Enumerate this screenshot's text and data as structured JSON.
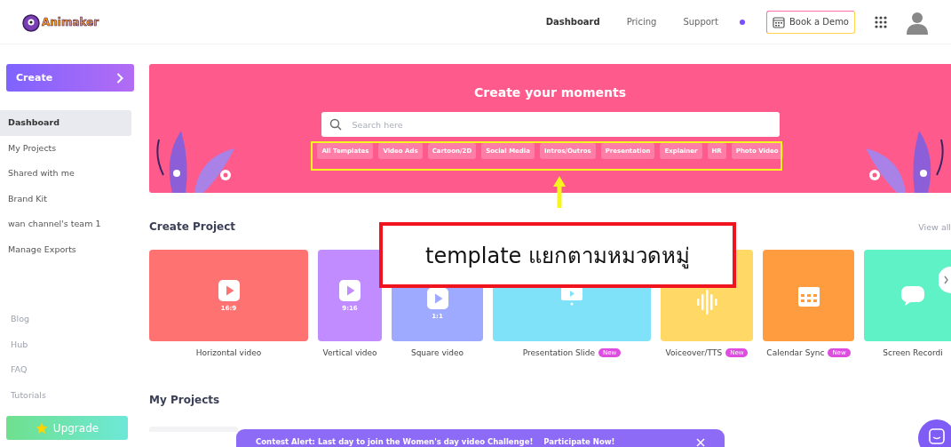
{
  "header": {
    "logo": "Animaker",
    "nav": [
      {
        "label": "Dashboard",
        "selected": true
      },
      {
        "label": "Pricing",
        "selected": false
      },
      {
        "label": "Support",
        "selected": false
      }
    ],
    "demo_button": "Book a Demo"
  },
  "sidebar": {
    "create_button": "Create",
    "items": [
      {
        "label": "Dashboard",
        "selected": true
      },
      {
        "label": "My Projects",
        "selected": false
      },
      {
        "label": "Shared with me",
        "selected": false
      },
      {
        "label": "Brand Kit",
        "selected": false
      },
      {
        "label": "wan channel's team 1",
        "selected": false
      },
      {
        "label": "Manage Exports",
        "selected": false
      }
    ],
    "links": [
      "Blog",
      "Hub",
      "FAQ",
      "Tutorials"
    ],
    "upgrade_button": "Upgrade"
  },
  "banner": {
    "title": "Create your moments",
    "search": {
      "placeholder": "Search here"
    },
    "chips": [
      "All Templates",
      "Video Ads",
      "Cartoon/2D",
      "Social Media",
      "Intros/Outros",
      "Presentation",
      "Explainer",
      "HR",
      "Photo Video"
    ]
  },
  "create_project": {
    "title": "Create Project",
    "view_all": "View all",
    "cards": [
      {
        "kind": "play",
        "label": "Horizontal video",
        "ratio": "16:9",
        "color": "#ff7272"
      },
      {
        "kind": "play",
        "label": "Vertical video",
        "ratio": "9:16",
        "color": "#c18cff"
      },
      {
        "kind": "play",
        "label": "Square video",
        "ratio": "1:1",
        "color": "#9daaff"
      },
      {
        "kind": "screen",
        "label": "Presentation Slide",
        "badge": "New",
        "color": "#7fe2f9"
      },
      {
        "kind": "wave",
        "label": "Voiceover/TTS",
        "badge": "New",
        "color": "#ffd866"
      },
      {
        "kind": "calendar",
        "label": "Calendar Sync",
        "badge": "New",
        "color": "#ff9c40"
      },
      {
        "kind": "chat",
        "label": "Screen Recordi",
        "color": "#5ff2c6"
      }
    ]
  },
  "my_projects": {
    "title": "My Projects"
  },
  "contest_bar": {
    "text": "Contest Alert: Last day to join the Women's day video Challenge!",
    "link": "Participate Now!"
  },
  "annotation": {
    "text": "template แยกตามหมวดหมู่"
  }
}
